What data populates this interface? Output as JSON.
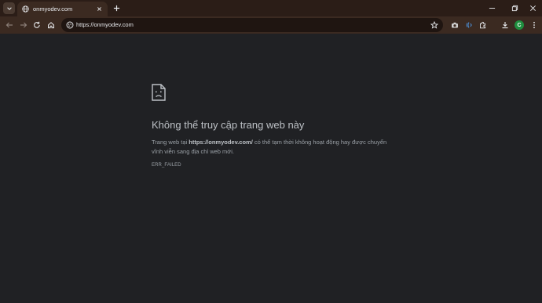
{
  "tab": {
    "title": "onmyodev.com"
  },
  "address_bar": {
    "url": "https://onmyodev.com"
  },
  "icons": {
    "tab_search": "chevron-down-icon",
    "favicon": "globe-icon",
    "tab_close": "close-icon",
    "new_tab": "plus-icon",
    "minimize": "minimize-icon",
    "maximize": "restore-icon",
    "close_window": "close-icon",
    "back": "arrow-left-icon",
    "forward": "arrow-right-icon",
    "reload": "refresh-icon",
    "home": "home-icon",
    "site_info": "tune-icon",
    "bookmark": "star-icon",
    "camera": "camera-icon",
    "wireless": "wireless-icon",
    "extensions": "puzzle-icon",
    "downloads": "download-icon",
    "menu": "kebab-menu-icon"
  },
  "profile": {
    "initial": "C"
  },
  "error": {
    "title": "Không thể truy cập trang web này",
    "desc_prefix": "Trang web tại ",
    "desc_url": "https://onmyodev.com/",
    "desc_suffix": " có thể tạm thời không hoạt động hay được chuyển vĩnh viễn sang địa chỉ web mới.",
    "code": "ERR_FAILED"
  },
  "colors": {
    "page_bg": "#202124",
    "tabstrip_bg": "#2b1d17",
    "toolbar_bg": "#3b2a21",
    "omnibox_bg": "#1f1511",
    "profile_green": "#1e8e3e"
  }
}
